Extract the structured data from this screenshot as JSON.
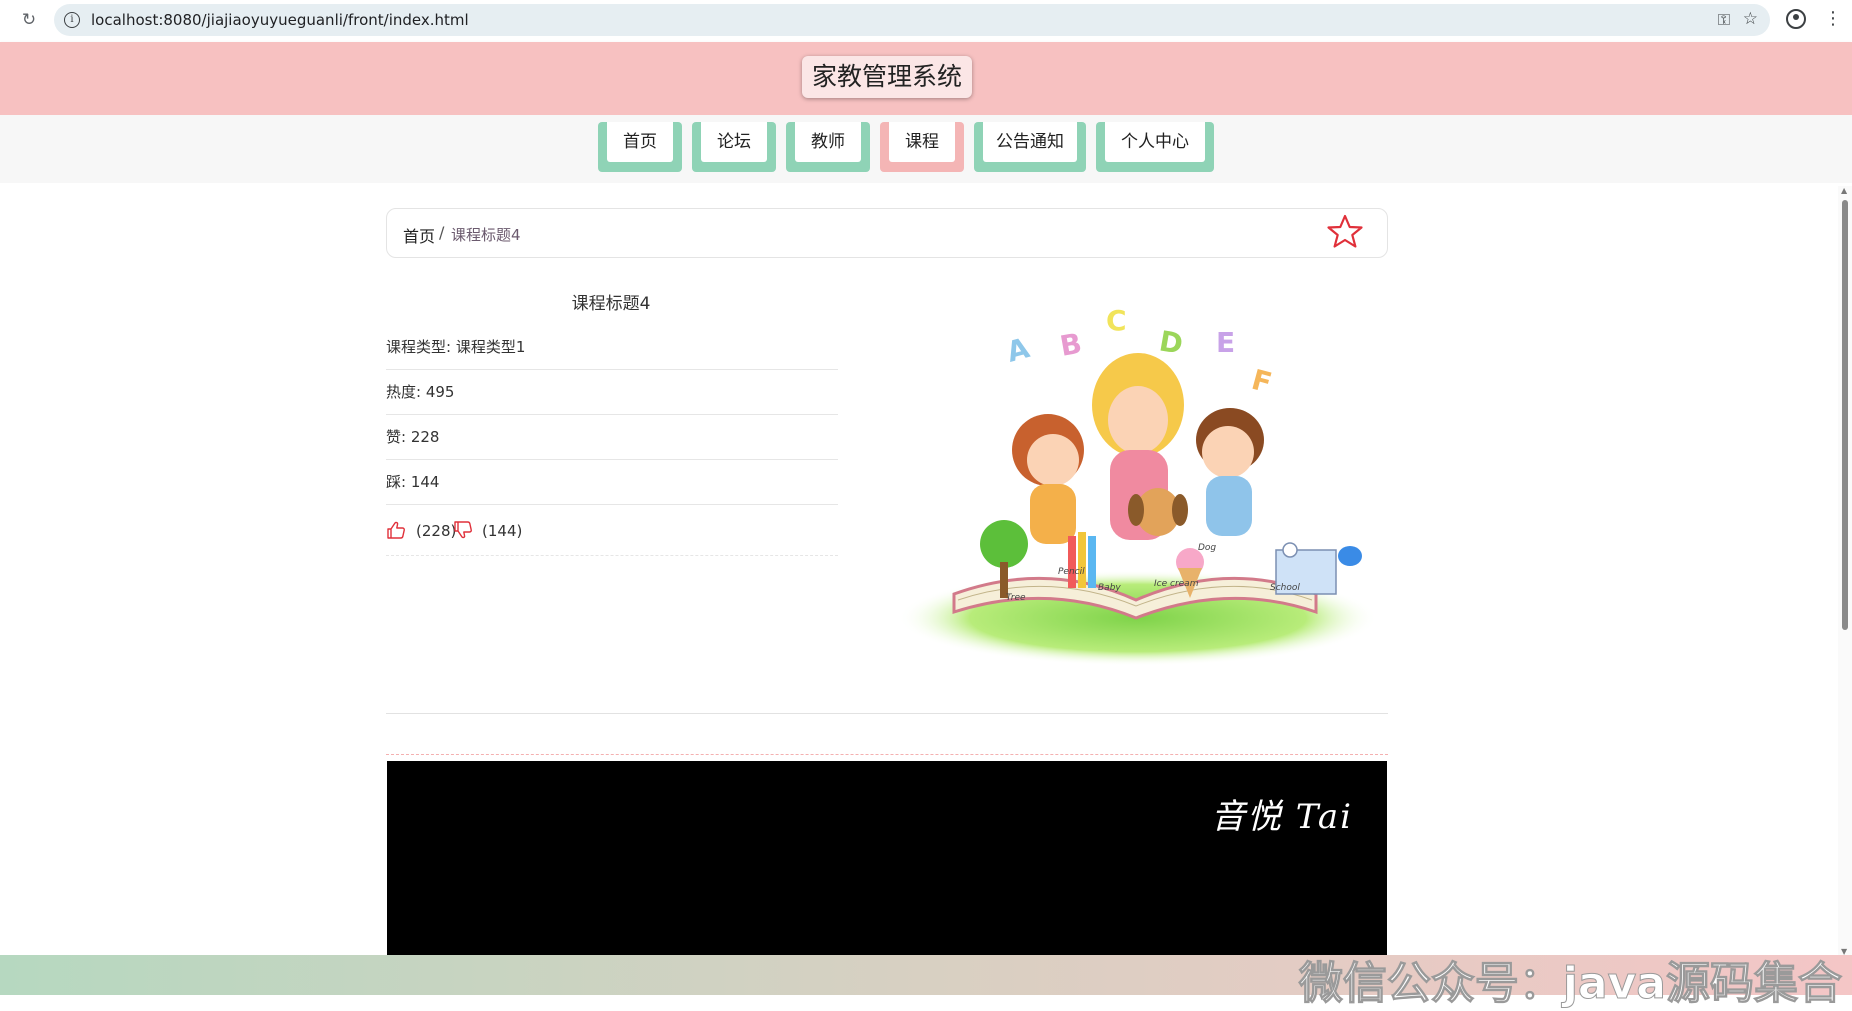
{
  "browser": {
    "url": "localhost:8080/jiajiaoyuyueguanli/front/index.html",
    "reload_icon": "reload-icon",
    "info_icon": "info-icon"
  },
  "site": {
    "title": "家教管理系统"
  },
  "nav": {
    "items": [
      {
        "label": "首页"
      },
      {
        "label": "论坛"
      },
      {
        "label": "教师"
      },
      {
        "label": "课程"
      },
      {
        "label": "公告通知"
      },
      {
        "label": "个人中心"
      }
    ],
    "active_index": 3
  },
  "breadcrumb": {
    "home": "首页",
    "separator": "/",
    "current": "课程标题4"
  },
  "detail": {
    "title": "课程标题4",
    "rows": [
      {
        "text": "课程类型: 课程类型1"
      },
      {
        "text": "热度: 495"
      },
      {
        "text": "赞: 228"
      },
      {
        "text": "踩: 144"
      }
    ],
    "like_count": "(228)",
    "dislike_count": "(144)"
  },
  "illustration": {
    "letters": [
      "A",
      "B",
      "C",
      "D",
      "E",
      "F"
    ],
    "book_labels": [
      "Tree",
      "Pencil",
      "Baby",
      "Ice cream",
      "Dog",
      "School"
    ]
  },
  "video": {
    "watermark": "音悦 Tai"
  },
  "overlay": {
    "watermark": "微信公众号：java源码集合"
  },
  "colors": {
    "header_bg": "#f7c1c1",
    "nav_accent": "#8fd3b6",
    "nav_active": "#f4b5b5",
    "favorite_star": "#e0303a"
  }
}
